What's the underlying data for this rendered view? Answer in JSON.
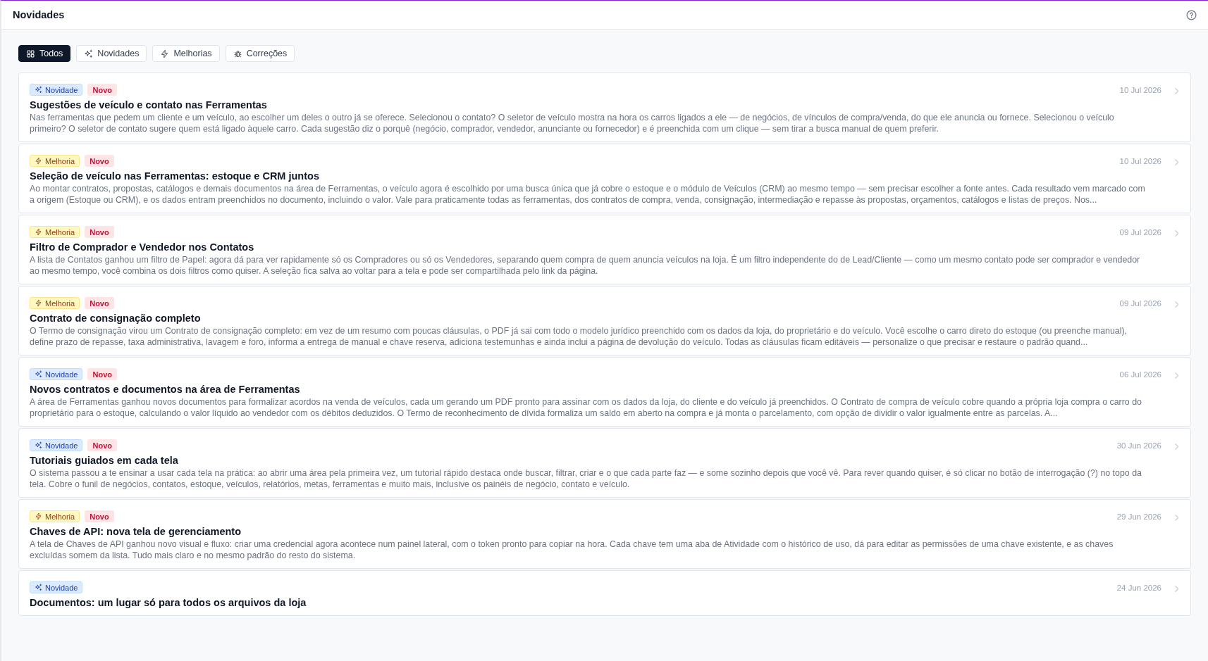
{
  "header": {
    "title": "Novidades"
  },
  "filters": [
    {
      "label": "Todos",
      "kind": "all",
      "selected": true
    },
    {
      "label": "Novidades",
      "kind": "feature",
      "selected": false
    },
    {
      "label": "Melhorias",
      "kind": "improvement",
      "selected": false
    },
    {
      "label": "Correções",
      "kind": "fix",
      "selected": false
    }
  ],
  "entries": [
    {
      "kind": "feature",
      "type_label": "Novidade",
      "is_new": true,
      "new_label": "Novo",
      "date": "10 Jul 2026",
      "title": "Sugestões de veículo e contato nas Ferramentas",
      "description": "Nas ferramentas que pedem um cliente e um veículo, ao escolher um deles o outro já se oferece. Selecionou o contato? O seletor de veículo mostra na hora os carros ligados a ele — de negócios, de vínculos de compra/venda, do que ele anuncia ou fornece. Selecionou o veículo primeiro? O seletor de contato sugere quem está ligado àquele carro. Cada sugestão diz o porquê (negócio, comprador, vendedor, anunciante ou fornecedor) e é preenchida com um clique — sem tirar a busca manual de quem preferir."
    },
    {
      "kind": "improvement",
      "type_label": "Melhoria",
      "is_new": true,
      "new_label": "Novo",
      "date": "10 Jul 2026",
      "title": "Seleção de veículo nas Ferramentas: estoque e CRM juntos",
      "description": "Ao montar contratos, propostas, catálogos e demais documentos na área de Ferramentas, o veículo agora é escolhido por uma busca única que já cobre o estoque e o módulo de Veículos (CRM) ao mesmo tempo — sem precisar escolher a fonte antes. Cada resultado vem marcado com a origem (Estoque ou CRM), e os dados entram preenchidos no documento, incluindo o valor. Vale para praticamente todas as ferramentas, dos contratos de compra, venda, consignação, intermediação e repasse às propostas, orçamentos, catálogos e listas de preços. Nos..."
    },
    {
      "kind": "improvement",
      "type_label": "Melhoria",
      "is_new": true,
      "new_label": "Novo",
      "date": "09 Jul 2026",
      "title": "Filtro de Comprador e Vendedor nos Contatos",
      "description": "A lista de Contatos ganhou um filtro de Papel: agora dá para ver rapidamente só os Compradores ou só os Vendedores, separando quem compra de quem anuncia veículos na loja. É um filtro independente do de Lead/Cliente — como um mesmo contato pode ser comprador e vendedor ao mesmo tempo, você combina os dois filtros como quiser. A seleção fica salva ao voltar para a tela e pode ser compartilhada pelo link da página."
    },
    {
      "kind": "improvement",
      "type_label": "Melhoria",
      "is_new": true,
      "new_label": "Novo",
      "date": "09 Jul 2026",
      "title": "Contrato de consignação completo",
      "description": "O Termo de consignação virou um Contrato de consignação completo: em vez de um resumo com poucas cláusulas, o PDF já sai com todo o modelo jurídico preenchido com os dados da loja, do proprietário e do veículo. Você escolhe o carro direto do estoque (ou preenche manual), define prazo de repasse, taxa administrativa, lavagem e foro, informa a entrega de manual e chave reserva, adiciona testemunhas e ainda inclui a página de devolução do veículo. Todas as cláusulas ficam editáveis — personalize o que precisar e restaure o padrão quand..."
    },
    {
      "kind": "feature",
      "type_label": "Novidade",
      "is_new": true,
      "new_label": "Novo",
      "date": "06 Jul 2026",
      "title": "Novos contratos e documentos na área de Ferramentas",
      "description": "A área de Ferramentas ganhou novos documentos para formalizar acordos na venda de veículos, cada um gerando um PDF pronto para assinar com os dados da loja, do cliente e do veículo já preenchidos. O Contrato de compra de veículo cobre quando a própria loja compra o carro do proprietário para o estoque, calculando o valor líquido ao vendedor com os débitos deduzidos. O Termo de reconhecimento de dívida formaliza um saldo em aberto na compra e já monta o parcelamento, com opção de dividir o valor igualmente entre as parcelas. A..."
    },
    {
      "kind": "feature",
      "type_label": "Novidade",
      "is_new": true,
      "new_label": "Novo",
      "date": "30 Jun 2026",
      "title": "Tutoriais guiados em cada tela",
      "description": "O sistema passou a te ensinar a usar cada tela na prática: ao abrir uma área pela primeira vez, um tutorial rápido destaca onde buscar, filtrar, criar e o que cada parte faz — e some sozinho depois que você vê. Para rever quando quiser, é só clicar no botão de interrogação (?) no topo da tela. Cobre o funil de negócios, contatos, estoque, veículos, relatórios, metas, ferramentas e muito mais, inclusive os painéis de negócio, contato e veículo."
    },
    {
      "kind": "improvement",
      "type_label": "Melhoria",
      "is_new": true,
      "new_label": "Novo",
      "date": "29 Jun 2026",
      "title": "Chaves de API: nova tela de gerenciamento",
      "description": "A tela de Chaves de API ganhou novo visual e fluxo: criar uma credencial agora acontece num painel lateral, com o token pronto para copiar na hora. Cada chave tem uma aba de Atividade com o histórico de uso, dá para editar as permissões de uma chave existente, e as chaves excluídas somem da lista. Tudo mais claro e no mesmo padrão do resto do sistema."
    },
    {
      "kind": "feature",
      "type_label": "Novidade",
      "is_new": false,
      "date": "24 Jun 2026",
      "title": "Documentos: um lugar só para todos os arquivos da loja"
    }
  ]
}
